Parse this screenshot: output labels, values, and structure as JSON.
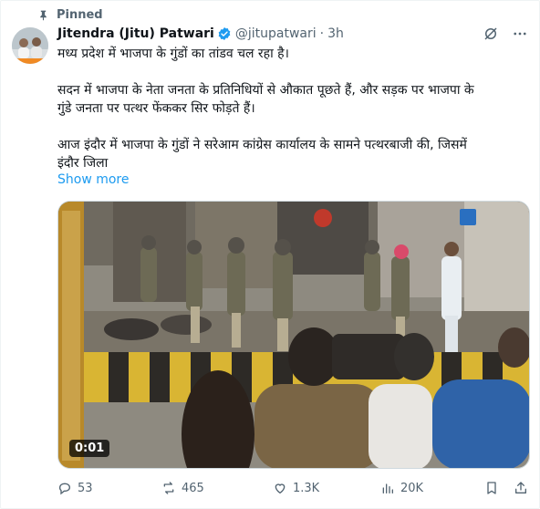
{
  "pinned": {
    "label": "Pinned"
  },
  "author": {
    "name": "Jitendra (Jitu) Patwari",
    "handle": "@jitupatwari",
    "separator": "·",
    "time": "3h"
  },
  "tweet": {
    "line1": "मध्य प्रदेश में भाजपा के गुंडों का तांडव चल रहा है।",
    "line2a": "सदन में भाजपा के नेता जनता के प्रतिनिधियों से औकात पूछते हैं, और सड़क पर भाजपा के",
    "line2b": "गुंडे जनता पर पत्थर फेंककर सिर फोड़ते हैं।",
    "line3a": "आज इंदौर में भाजपा के गुंडों ने सरेआम कांग्रेस कार्यालय के सामने पत्थरबाजी की, जिसमें",
    "line3b": "इंदौर जिला",
    "show_more": "Show more"
  },
  "media": {
    "duration": "0:01"
  },
  "actions": {
    "replies": "53",
    "reposts": "465",
    "likes": "1.3K",
    "views": "20K"
  },
  "colors": {
    "accent": "#1d9bf0",
    "secondary_text": "#536471"
  },
  "icons": [
    "pin-icon",
    "verified-badge-icon",
    "grok-icon",
    "more-icon",
    "reply-icon",
    "repost-icon",
    "like-icon",
    "views-icon",
    "bookmark-icon",
    "share-icon"
  ]
}
